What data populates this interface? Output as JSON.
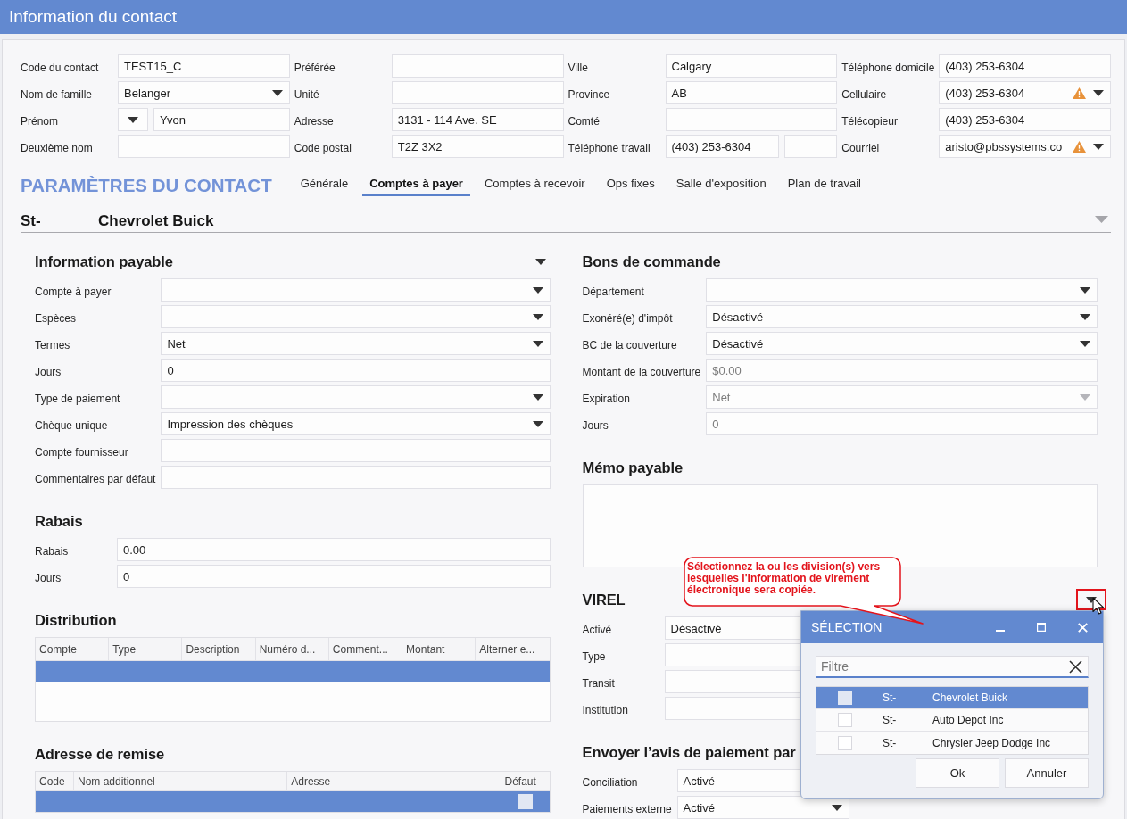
{
  "window": {
    "title": "Information du contact"
  },
  "contact": {
    "columns": [
      {
        "fields": [
          {
            "label": "Code du contact",
            "kind": "text",
            "value": "TEST15_C",
            "warning": false
          },
          {
            "label": "Nom de famille",
            "kind": "dropdown",
            "value": "Belanger",
            "warning": false
          },
          {
            "label": "Prénom",
            "kind": "prefixed",
            "value": "Yvon",
            "warning": false
          },
          {
            "label": "Deuxième nom",
            "kind": "text",
            "warning": false
          }
        ]
      },
      {
        "fields": [
          {
            "label": "Préférée",
            "kind": "text",
            "warning": false
          },
          {
            "label": "Unité",
            "kind": "text",
            "warning": false
          },
          {
            "label": "Adresse",
            "kind": "text",
            "value": "3131 - 114 Ave. SE",
            "warning": false
          },
          {
            "label": "Code postal",
            "kind": "text",
            "value": "T2Z 3X2",
            "warning": false
          }
        ]
      },
      {
        "fields": [
          {
            "label": "Ville",
            "kind": "text",
            "value": "Calgary",
            "warning": false
          },
          {
            "label": "Province",
            "kind": "text",
            "value": "AB",
            "warning": false
          },
          {
            "label": "Comté",
            "kind": "text",
            "warning": false
          },
          {
            "label": "Téléphone travail",
            "kind": "phone",
            "value": "(403) 253-6304",
            "warning": false
          }
        ]
      },
      {
        "fields": [
          {
            "label": "Téléphone domicile",
            "kind": "text",
            "value": "(403) 253-6304",
            "warning": false
          },
          {
            "label": "Cellulaire",
            "kind": "dropdown",
            "value": "(403) 253-6304",
            "warning": true
          },
          {
            "label": "Télécopieur",
            "kind": "text",
            "value": "(403) 253-6304",
            "warning": false
          },
          {
            "label": "Courriel",
            "kind": "dropdown",
            "value": "aristo@pbssystems.co",
            "warning": true
          }
        ]
      }
    ]
  },
  "contact_settings": {
    "title": "PARAMÈTRES DU CONTACT",
    "tabs": [
      {
        "label": "Générale",
        "selected": false
      },
      {
        "label": "Comptes à payer",
        "selected": true
      },
      {
        "label": "Comptes à recevoir",
        "selected": false
      },
      {
        "label": "Ops fixes",
        "selected": false
      },
      {
        "label": "Salle d'exposition",
        "selected": false
      },
      {
        "label": "Plan de travail",
        "selected": false
      }
    ]
  },
  "division": {
    "code": "St-",
    "name": "Chevrolet Buick"
  },
  "left_sections": [
    {
      "title": "Information payable",
      "kind": "form",
      "collapsible": true,
      "highlighted": false,
      "rows": [
        {
          "label": "Compte à payer",
          "kind": "dropdown"
        },
        {
          "label": "Espèces",
          "kind": "dropdown"
        },
        {
          "label": "Termes",
          "kind": "dropdown",
          "value": "Net"
        },
        {
          "label": "Jours",
          "kind": "text",
          "value": "0"
        },
        {
          "label": "Type de paiement",
          "kind": "dropdown"
        },
        {
          "label": "Chèque unique",
          "kind": "dropdown",
          "value": "Impression des chèques"
        },
        {
          "label": "Compte fournisseur",
          "kind": "text"
        },
        {
          "label": "Commentaires par défaut",
          "kind": "text"
        }
      ]
    },
    {
      "title": "Rabais",
      "kind": "form",
      "collapsible": false,
      "highlighted": false,
      "rows": [
        {
          "label": "Rabais",
          "kind": "text",
          "value": "0.00"
        },
        {
          "label": "Jours",
          "kind": "text",
          "value": "0"
        }
      ]
    },
    {
      "title": "Distribution",
      "kind": "table",
      "collapsible": false,
      "highlighted": false,
      "columns": [
        "Compte",
        "Type",
        "Description",
        "Numéro d...",
        "Comment...",
        "Montant",
        "Alterner e..."
      ],
      "rows": [
        {
          "selected": true
        }
      ]
    },
    {
      "title": "Adresse de remise",
      "kind": "address_table",
      "collapsible": false,
      "highlighted": false,
      "columns": [
        "Code",
        "Nom additionnel",
        "Adresse",
        "Défaut"
      ],
      "rows": [
        {
          "selected": true,
          "checked": false
        }
      ]
    }
  ],
  "right_sections": [
    {
      "title": "Bons de commande",
      "kind": "form",
      "collapsible": false,
      "highlighted": false,
      "rows": [
        {
          "label": "Département",
          "kind": "dropdown",
          "disabled": false
        },
        {
          "label": "Exonéré(e) d'impôt",
          "kind": "dropdown",
          "value": "Désactivé",
          "disabled": false
        },
        {
          "label": "BC de la couverture",
          "kind": "dropdown",
          "value": "Désactivé",
          "disabled": false
        },
        {
          "label": "Montant de la couverture",
          "kind": "text",
          "value": "$0.00",
          "disabled": true
        },
        {
          "label": "Expiration",
          "kind": "dropdown",
          "value": "Net",
          "disabled": true
        },
        {
          "label": "Jours",
          "kind": "text",
          "value": "0",
          "disabled": true
        }
      ]
    },
    {
      "title": "Mémo payable",
      "kind": "memo",
      "collapsible": false,
      "highlighted": false
    },
    {
      "title": "VIREL",
      "kind": "compact_form",
      "collapsible": true,
      "highlighted": true,
      "rows": [
        {
          "label": "Activé",
          "kind": "text",
          "value": "Désactivé"
        },
        {
          "label": "Type",
          "kind": "text"
        },
        {
          "label": "Transit",
          "kind": "text"
        },
        {
          "label": "Institution",
          "kind": "text"
        }
      ]
    },
    {
      "title": "Envoyer l’avis de paiement par",
      "kind": "compact_form",
      "collapsible": false,
      "highlighted": false,
      "rows": [
        {
          "label": "Conciliation",
          "kind": "text",
          "value": "Activé"
        },
        {
          "label": "Paiements externe",
          "kind": "dropdown",
          "value": "Activé"
        }
      ]
    }
  ],
  "callout": {
    "text": "Sélectionnez la ou les division(s) vers lesquelles l'information de virement électronique sera copiée."
  },
  "selection_dialog": {
    "title": "SÉLECTION",
    "filter": {
      "placeholder": "Filtre"
    },
    "rows": [
      {
        "code": "St-",
        "name": "Chevrolet Buick",
        "selected": true,
        "checked": false
      },
      {
        "code": "St-",
        "name": "Auto Depot Inc",
        "selected": false,
        "checked": false
      },
      {
        "code": "St-",
        "name": "Chrysler Jeep Dodge Inc",
        "selected": false,
        "checked": false
      }
    ],
    "buttons": [
      "Ok",
      "Annuler"
    ]
  }
}
